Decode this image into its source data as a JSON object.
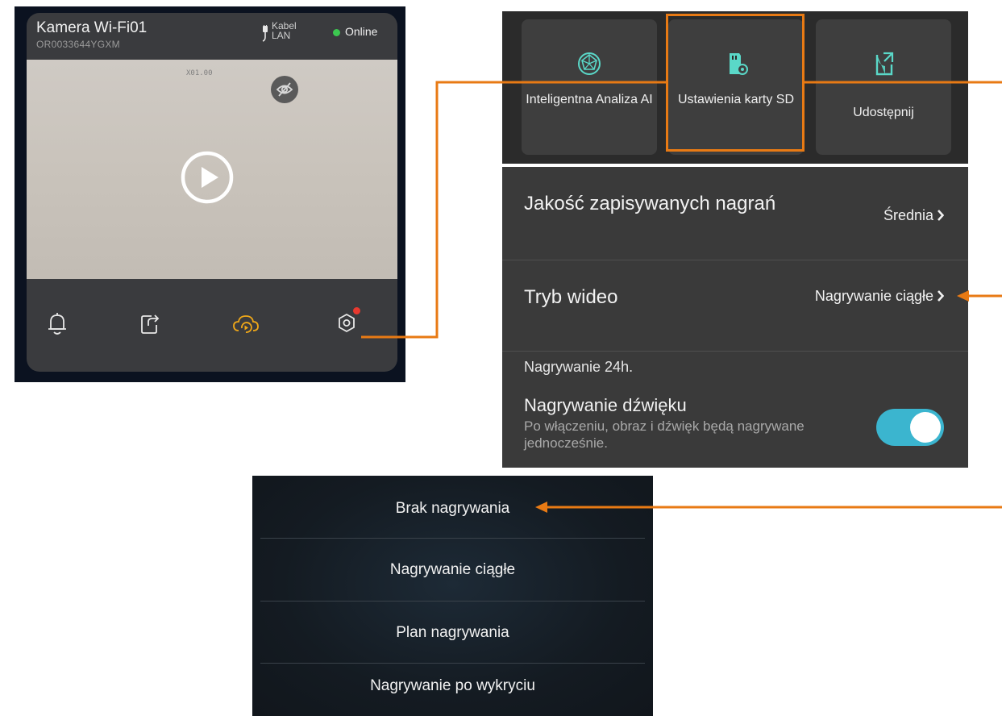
{
  "camera": {
    "name": "Kamera Wi-Fi01",
    "serial": "OR0033644YGXM",
    "connection": "Kabel LAN",
    "status": "Online",
    "zoom": "X01.00"
  },
  "features": {
    "items": [
      {
        "label": "Inteligentna Analiza AI",
        "icon": "ai-analysis-icon"
      },
      {
        "label": "Ustawienia karty SD",
        "icon": "sd-card-settings-icon"
      },
      {
        "label": "Udostępnij",
        "icon": "share-icon"
      }
    ]
  },
  "sd_settings": {
    "quality_label": "Jakość zapisywanych nagrań",
    "quality_value": "Średnia",
    "video_mode_label": "Tryb wideo",
    "video_mode_value": "Nagrywanie ciągłe",
    "note": "Nagrywanie 24h.",
    "audio_label": "Nagrywanie dźwięku",
    "audio_description": "Po włączeniu, obraz i dźwięk będą nagrywane jednocześnie.",
    "audio_enabled": true
  },
  "recording_modes": {
    "options": [
      "Brak nagrywania",
      "Nagrywanie ciągłe",
      "Plan nagrywania",
      "Nagrywanie po wykryciu"
    ]
  },
  "colors": {
    "accent": "#e87a14",
    "online": "#3cc850",
    "toggle_on": "#3bb5cf",
    "cloud_icon": "#f0a818",
    "badge": "#e8392f"
  }
}
